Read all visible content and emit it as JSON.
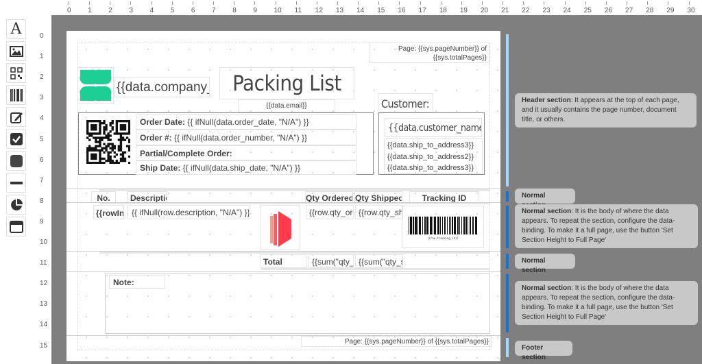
{
  "toolbar": {
    "tools": [
      {
        "name": "text-tool",
        "glyph": "A"
      },
      {
        "name": "image-tool"
      },
      {
        "name": "qrcode-tool"
      },
      {
        "name": "barcode-tool"
      },
      {
        "name": "signature-tool"
      },
      {
        "name": "checkbox-tool"
      },
      {
        "name": "shape-tool"
      },
      {
        "name": "line-tool"
      },
      {
        "name": "chart-tool"
      },
      {
        "name": "container-tool"
      }
    ]
  },
  "ruler": {
    "h": [
      "0",
      "1",
      "2",
      "3",
      "4",
      "5",
      "6",
      "7",
      "8",
      "9",
      "10",
      "11",
      "12",
      "13",
      "14",
      "15",
      "16",
      "17",
      "18",
      "19",
      "20",
      "21",
      "22",
      "23",
      "24",
      "25",
      "26",
      "27",
      "28",
      "29",
      "30"
    ],
    "v": [
      "0",
      "1",
      "2",
      "3",
      "4",
      "5",
      "6",
      "7",
      "8",
      "9",
      "10",
      "11",
      "12",
      "13",
      "14",
      "15"
    ]
  },
  "header": {
    "page_number": "Page: {{sys.pageNumber}} of {{sys.totalPages}}",
    "company": "{{data.company_name}}",
    "title": "Packing List",
    "email": "{{data.email}}",
    "order_date_label": "Order Date:",
    "order_date_value": " {{ ifNull(data.order_date, \"N/A\") }}",
    "order_no_label": "Order #:",
    "order_no_value": " {{ ifNull(data.order_number, \"N/A\") }}",
    "partial_label": "Partial/Complete Order:",
    "ship_date_label": "Ship Date:",
    "ship_date_value": " {{ ifNull(data.ship_date, \"N/A\") }}",
    "customer_label": "Customer:",
    "customer_name": "{{data.customer_name}}",
    "addresses": [
      "{{data.ship_to_address3}}",
      "{{data.ship_to_address2}}",
      "{{data.ship_to_address3}}"
    ]
  },
  "table": {
    "headers": {
      "no": "No.",
      "description": "Description",
      "qty_ordered": "Qty Ordered",
      "qty_shipped": "Qty Shipped",
      "tracking": "Tracking ID"
    },
    "row": {
      "no": "{{rowIndex}}",
      "description": "{{ ifNull(row.description, \"N/A\") }}",
      "qty_ordered": "{{row.qty_ordered}}",
      "qty_shipped": "{{row.qty_shipped}}",
      "barcode_text": "{{row.tracking_id}}"
    },
    "total": {
      "label": "Total",
      "sum_ordered": "{{sum(\"qty_ordered\")}}",
      "sum_shipped": "{{sum(\"qty_shipped\")}}"
    }
  },
  "note": {
    "label": "Note:"
  },
  "footer": {
    "page_number": "Page: {{sys.pageNumber}} of {{sys.totalPages}}"
  },
  "sections": {
    "header": {
      "title": "Header section",
      "desc": ": It appears at the top of each page, and it usually contains the page number, document title, or others."
    },
    "normal1": {
      "title": "Normal section"
    },
    "normal2": {
      "title": "Normal section",
      "desc": ": It is the body of where the data appears. To repeat the section, configure the data-binding. To make it a full page, use the button 'Set Section Height to Full Page'"
    },
    "normal3": {
      "title": "Normal section"
    },
    "normal4": {
      "title": "Normal section",
      "desc": ": It is the body of where the data appears. To repeat the section, configure the data-binding. To make it a full page, use the button 'Set Section Height to Full Page'"
    },
    "footer": {
      "title": "Footer section"
    }
  },
  "colors": {
    "logo": "#1dcf94",
    "accent": "#ff3b4e",
    "header_bar": "#a6d8f5",
    "normal_bar": "#1673d0"
  }
}
